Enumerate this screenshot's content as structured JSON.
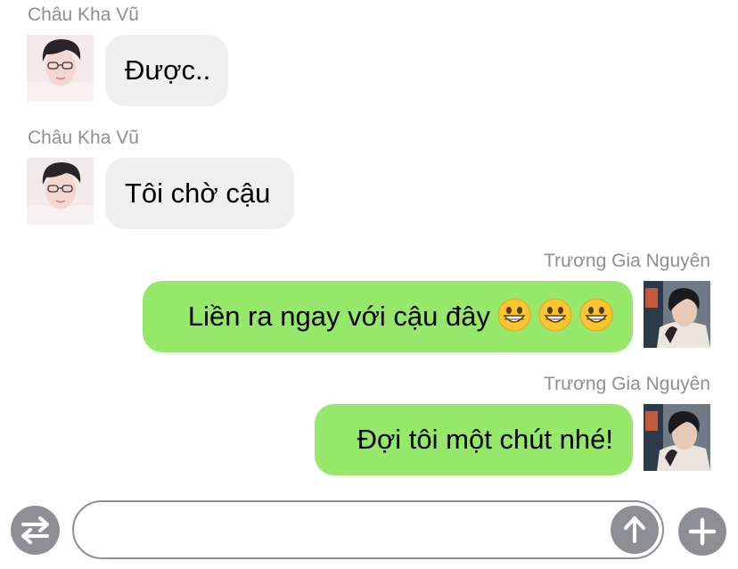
{
  "messages": [
    {
      "sender": "Châu Kha Vũ",
      "text": "Được..",
      "direction": "incoming",
      "avatar": "avatar-chau-kha-vu"
    },
    {
      "sender": "Châu Kha Vũ",
      "text": "Tôi chờ cậu",
      "direction": "incoming",
      "avatar": "avatar-chau-kha-vu"
    },
    {
      "sender": "Trương Gia Nguyên",
      "text": "Liền ra ngay với cậu đây",
      "emojis": [
        "grinning-face-icon",
        "grinning-face-icon",
        "grinning-face-icon"
      ],
      "direction": "outgoing",
      "avatar": "avatar-truong-gia-nguyen"
    },
    {
      "sender": "Trương Gia Nguyên",
      "text": "Đợi tôi một chút nhé!",
      "direction": "outgoing",
      "avatar": "avatar-truong-gia-nguyen"
    }
  ],
  "input_bar": {
    "left_icon": "swap-arrows-icon",
    "text_value": "",
    "send_icon": "arrow-up-icon",
    "add_icon": "plus-icon"
  },
  "colors": {
    "incoming_bubble": "#efeff0",
    "outgoing_bubble": "#95e86a",
    "name_text": "#8e8e93",
    "icon_gray": "#8e8f95"
  }
}
